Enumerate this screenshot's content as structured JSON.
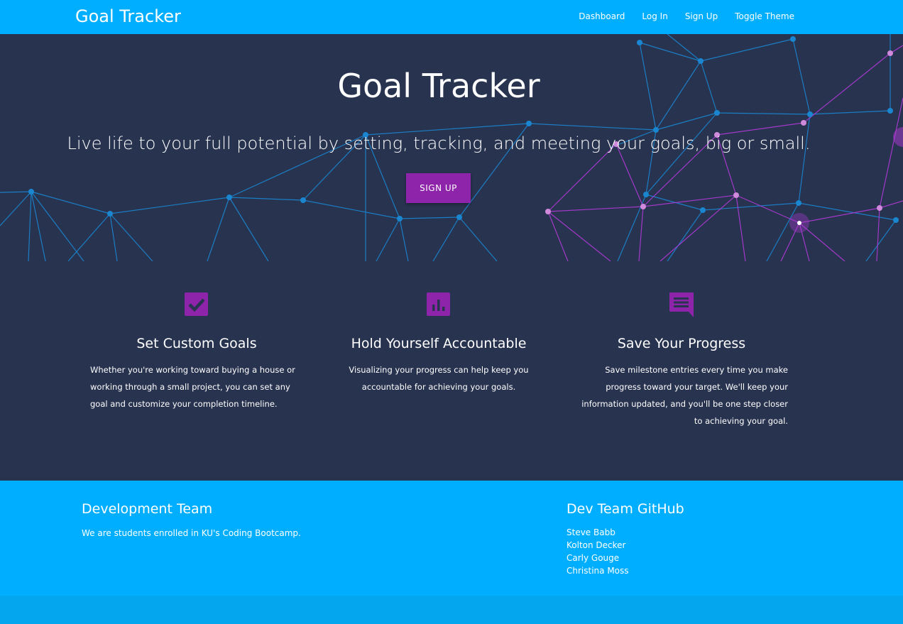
{
  "navbar": {
    "brand": "Goal Tracker",
    "links": [
      "Dashboard",
      "Log In",
      "Sign Up",
      "Toggle Theme"
    ]
  },
  "hero": {
    "title": "Goal Tracker",
    "subtitle": "Live life to your full potential by setting, tracking, and meeting your goals, big or small.",
    "cta": "SIGN UP"
  },
  "features": [
    {
      "icon": "check-box-icon",
      "title": "Set Custom Goals",
      "text": "Whether you're working toward buying a house or working through a small project, you can set any goal and customize your completion timeline."
    },
    {
      "icon": "bar-chart-icon",
      "title": "Hold Yourself Accountable",
      "text": "Visualizing your progress can help keep you accountable for achieving your goals."
    },
    {
      "icon": "chat-message-icon",
      "title": "Save Your Progress",
      "text": "Save milestone entries every time you make progress toward your target. We'll keep your information updated, and you'll be one step closer to achieving your goal."
    }
  ],
  "footer": {
    "team_heading": "Development Team",
    "team_text": "We are students enrolled in KU's Coding Bootcamp.",
    "github_heading": "Dev Team GitHub",
    "members": [
      "Steve Babb",
      "Kolton Decker",
      "Carly Gouge",
      "Christina Moss"
    ]
  },
  "colors": {
    "primary": "#00aeff",
    "background": "#283350",
    "accent": "#8e24aa",
    "network_blue": "#1a86d0",
    "network_purple": "#b03ad6"
  }
}
